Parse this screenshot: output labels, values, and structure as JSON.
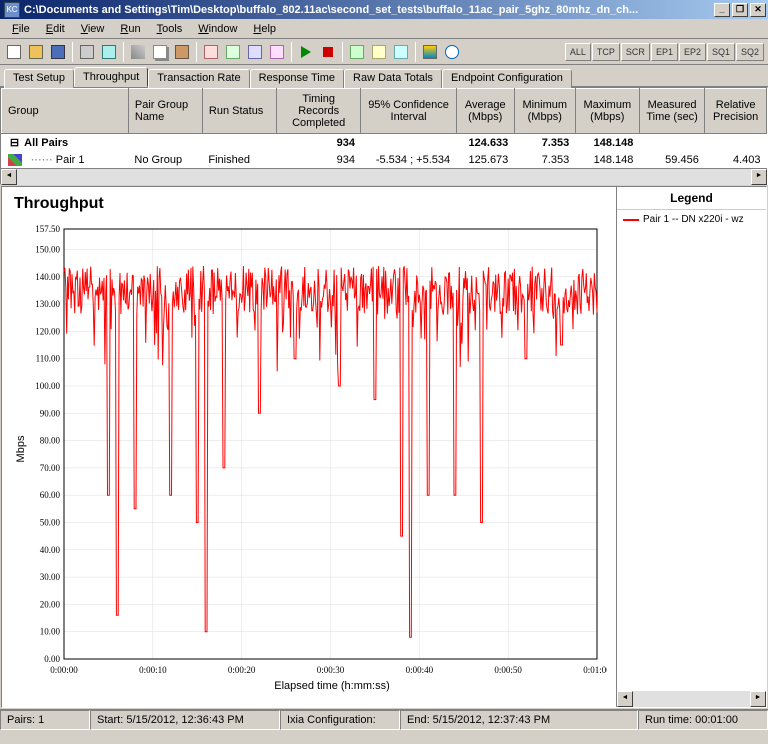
{
  "window": {
    "title": "C:\\Documents and Settings\\Tim\\Desktop\\buffalo_802.11ac\\second_set_tests\\buffalo_11ac_pair_5ghz_80mhz_dn_ch...",
    "icon_label": "KC"
  },
  "menu": [
    "File",
    "Edit",
    "View",
    "Run",
    "Tools",
    "Window",
    "Help"
  ],
  "toolbar_tracks": [
    "ALL",
    "TCP",
    "SCR",
    "EP1",
    "EP2",
    "SQ1",
    "SQ2"
  ],
  "tabs": [
    "Test Setup",
    "Throughput",
    "Transaction Rate",
    "Response Time",
    "Raw Data Totals",
    "Endpoint Configuration"
  ],
  "active_tab": 1,
  "table": {
    "columns": [
      "Group",
      "Pair Group Name",
      "Run Status",
      "Timing Records Completed",
      "95% Confidence Interval",
      "Average (Mbps)",
      "Minimum (Mbps)",
      "Maximum (Mbps)",
      "Measured Time (sec)",
      "Relative Precision"
    ],
    "all_pairs": {
      "label": "All Pairs",
      "timing_records": "934",
      "average": "124.633",
      "minimum": "7.353",
      "maximum": "148.148"
    },
    "pair1": {
      "label": "Pair 1",
      "group_name": "No Group",
      "status": "Finished",
      "timing_records": "934",
      "confidence": "-5.534 ; +5.534",
      "average": "125.673",
      "minimum": "7.353",
      "maximum": "148.148",
      "measured_time": "59.456",
      "precision": "4.403"
    }
  },
  "chart_title": "Throughput",
  "legend": {
    "title": "Legend",
    "item1": "Pair 1 -- DN x220i - wz"
  },
  "chart_data": {
    "type": "line",
    "title": "Throughput",
    "xlabel": "Elapsed time (h:mm:ss)",
    "ylabel": "Mbps",
    "ylim": [
      0,
      157.5
    ],
    "yticks": [
      0,
      10,
      20,
      30,
      40,
      50,
      60,
      70,
      80,
      90,
      100,
      110,
      120,
      130,
      140,
      150,
      157.5
    ],
    "xticks": [
      "0:00:00",
      "0:00:10",
      "0:00:20",
      "0:00:30",
      "0:00:40",
      "0:00:50",
      "0:01:00"
    ],
    "x_seconds": [
      0,
      10,
      20,
      30,
      40,
      50,
      60
    ],
    "series": [
      {
        "name": "Pair 1 -- DN x220i - wz",
        "color": "#ff0000",
        "note": "Dense noisy throughput trace ~130–140 Mbps baseline with deep downward spikes",
        "baseline_mean": 135,
        "baseline_min": 120,
        "baseline_max": 148,
        "deep_spikes_time_value": [
          [
            5,
            60
          ],
          [
            6,
            16
          ],
          [
            8,
            55
          ],
          [
            12,
            60
          ],
          [
            15,
            50
          ],
          [
            16,
            10
          ],
          [
            18,
            70
          ],
          [
            22,
            90
          ],
          [
            26,
            110
          ],
          [
            31,
            100
          ],
          [
            35,
            95
          ],
          [
            38,
            45
          ],
          [
            39,
            8
          ],
          [
            41,
            60
          ],
          [
            44,
            60
          ],
          [
            47,
            50
          ],
          [
            52,
            110
          ],
          [
            56,
            115
          ]
        ]
      }
    ]
  },
  "status": {
    "pairs": "Pairs: 1",
    "start": "Start: 5/15/2012, 12:36:43 PM",
    "ixia": "Ixia Configuration:",
    "end": "End: 5/15/2012, 12:37:43 PM",
    "runtime": "Run time: 00:01:00"
  }
}
